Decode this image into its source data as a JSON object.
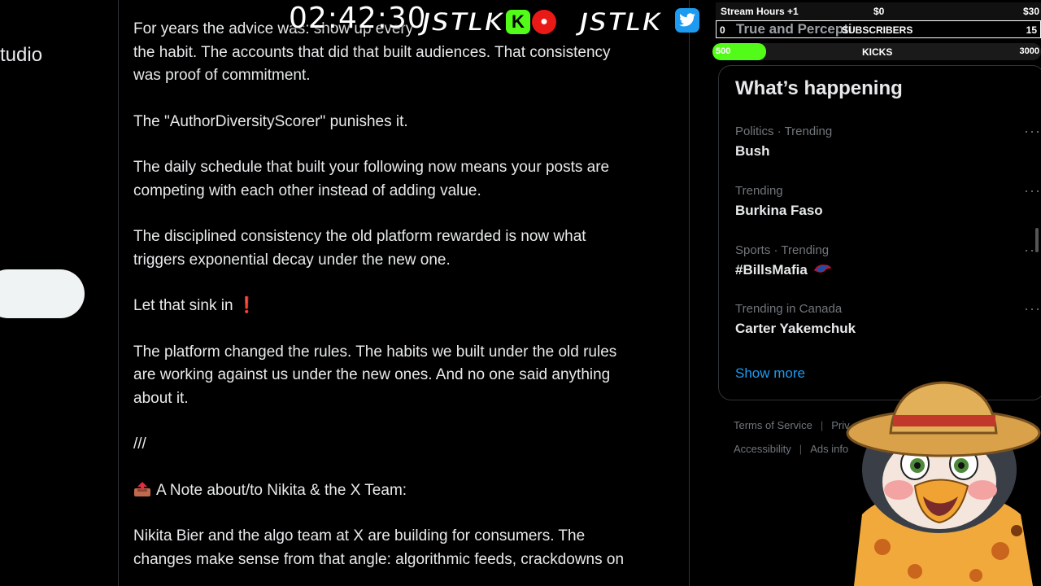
{
  "left": {
    "partial_label": "tudio"
  },
  "post": {
    "lines": [
      "For years the advice was: show up every",
      "the habit. The accounts that did that built audiences. That consistency",
      "was proof of commitment.",
      "The \"AuthorDiversityScorer\" punishes it.",
      "The daily schedule that built your following now means your posts are",
      "competing with each other instead of adding value.",
      "The disciplined consistency the old platform rewarded is now what",
      "triggers exponential decay under the new one.",
      "Let that sink in",
      "The platform changed the rules. The habits we built under the old rules",
      "are working against us under the new ones. And no one said anything",
      "about it.",
      "///",
      "A Note about/to Nikita & the X Team:",
      "Nikita Bier and the algo team at X are building for consumers. The",
      "changes make sense from that angle: algorithmic feeds, crackdowns on"
    ],
    "exclaim": "❗"
  },
  "happening": {
    "title": "What’s happening",
    "trends": [
      {
        "meta": "Politics · Trending",
        "name": "Bush"
      },
      {
        "meta": "Trending",
        "name": "Burkina Faso"
      },
      {
        "meta": "Sports · Trending",
        "name": "#BillsMafia"
      },
      {
        "meta": "Trending in Canada",
        "name": "Carter Yakemchuk"
      }
    ],
    "show_more": "Show more"
  },
  "footer": {
    "terms": "Terms of Service",
    "privacy": "Priv",
    "accessibility": "Accessibility",
    "ads": "Ads info"
  },
  "overlay": {
    "clock": "02:42:30",
    "logo": "JSTLK",
    "logo2": "JSTLK",
    "stream_hours": "Stream Hours +1",
    "stream_amt1": "$0",
    "stream_amt2": "$30",
    "subs_left": "0",
    "subs_label": "SUBSCRIBERS",
    "subs_right": "15",
    "subs_bg_text": "True and Percepti",
    "kicks_left": "500",
    "kicks_label": "KICKS",
    "kicks_right": "3000",
    "kicks_progress": 0.0
  }
}
